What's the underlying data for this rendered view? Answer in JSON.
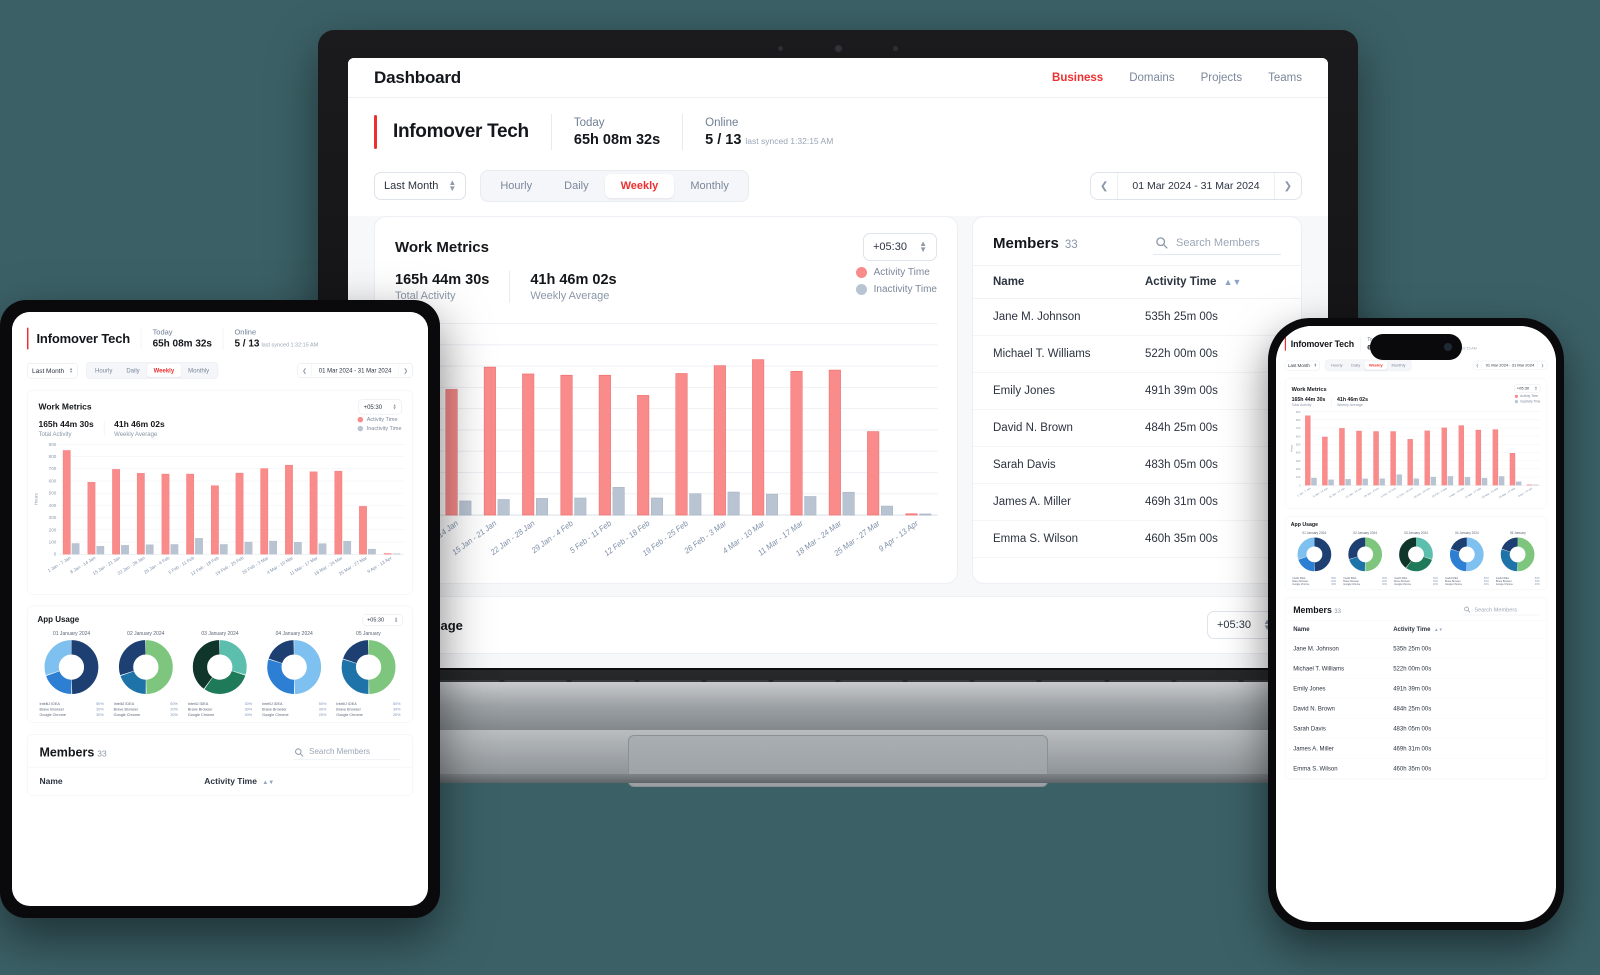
{
  "header": {
    "app_title": "Dashboard",
    "nav": [
      {
        "label": "Business",
        "active": true
      },
      {
        "label": "Domains",
        "active": false
      },
      {
        "label": "Projects",
        "active": false
      },
      {
        "label": "Teams",
        "active": false
      }
    ]
  },
  "brand": {
    "name": "Infomover Tech",
    "today_label": "Today",
    "today_value": "65h 08m 32s",
    "online_label": "Online",
    "online_value": "5 / 13",
    "last_synced": "last synced 1:32:15 AM"
  },
  "filters": {
    "period_select": "Last Month",
    "segments": [
      {
        "label": "Hourly",
        "active": false
      },
      {
        "label": "Daily",
        "active": false
      },
      {
        "label": "Weekly",
        "active": true
      },
      {
        "label": "Monthly",
        "active": false
      }
    ],
    "date_range": "01 Mar 2024 - 31 Mar 2024",
    "prev_icon": "chevron-left-icon",
    "next_icon": "chevron-right-icon"
  },
  "work_metrics": {
    "title": "Work Metrics",
    "timezone": "+05:30",
    "total_activity_value": "165h 44m 30s",
    "total_activity_label": "Total Activity",
    "weekly_average_value": "41h 46m 02s",
    "weekly_average_label": "Weekly Average",
    "legend": [
      {
        "label": "Activity Time",
        "color": "#f98b8b"
      },
      {
        "label": "Inactivity Time",
        "color": "#b9c4d2"
      }
    ]
  },
  "chart_data": {
    "type": "bar",
    "title": "Work Metrics",
    "xlabel": "",
    "ylabel": "Hours",
    "ylim": [
      0,
      900
    ],
    "yticks": [
      0,
      100,
      200,
      300,
      400,
      500,
      600,
      700,
      800,
      900
    ],
    "grid": true,
    "legend_position": "top-right",
    "categories": [
      "1 Jan - 7 Jan",
      "8 Jan - 14 Jan",
      "15 Jan - 21 Jan",
      "22 Jan - 28 Jan",
      "29 Jan - 4 Feb",
      "5 Feb - 11 Feb",
      "12 Feb - 18 Feb",
      "19 Feb - 25 Feb",
      "26 Feb - 3 Mar",
      "4 Mar - 10 Mar",
      "11 Mar - 17 Mar",
      "18 Mar - 24 Mar",
      "25 Mar - 27 Mar",
      "9 Apr - 13 Apr"
    ],
    "series": [
      {
        "name": "Activity Time",
        "color": "#f98b8b",
        "values": [
          850,
          590,
          695,
          663,
          657,
          657,
          562,
          665,
          702,
          730,
          675,
          681,
          392,
          6
        ]
      },
      {
        "name": "Inactivity Time",
        "color": "#b9c4d2",
        "values": [
          88,
          66,
          73,
          78,
          80,
          130,
          80,
          100,
          108,
          98,
          87,
          107,
          42,
          3
        ]
      }
    ]
  },
  "members": {
    "title": "Members",
    "count": "33",
    "search_placeholder": "Search Members",
    "search_icon": "search-icon",
    "columns": [
      "Name",
      "Activity Time"
    ],
    "sort_icon": "sort-updown-icon",
    "rows": [
      {
        "name": "Jane M. Johnson",
        "activity": "535h 25m 00s"
      },
      {
        "name": "Michael T. Williams",
        "activity": "522h 00m 00s"
      },
      {
        "name": "Emily Jones",
        "activity": "491h 39m 00s"
      },
      {
        "name": "David N. Brown",
        "activity": "484h 25m 00s"
      },
      {
        "name": "Sarah Davis",
        "activity": "483h 05m 00s"
      },
      {
        "name": "James A. Miller",
        "activity": "469h 31m 00s"
      },
      {
        "name": "Emma S. Wilson",
        "activity": "460h 35m 00s"
      }
    ]
  },
  "app_usage": {
    "title": "App Usage",
    "timezone": "+05:30",
    "charts": [
      {
        "date": "01 January 2024",
        "slices": [
          {
            "label": "IntelliJ IDEA",
            "pct": "50%",
            "value": 50,
            "color": "#1d3f72"
          },
          {
            "label": "Brave Browser",
            "pct": "20%",
            "value": 20,
            "color": "#2d7fd4"
          },
          {
            "label": "Google Chrome",
            "pct": "30%",
            "value": 30,
            "color": "#7ec0ef"
          }
        ]
      },
      {
        "date": "02 January 2024",
        "slices": [
          {
            "label": "IntelliJ IDEA",
            "pct": "50%",
            "value": 50,
            "color": "#7ec67e"
          },
          {
            "label": "Brave Browser",
            "pct": "20%",
            "value": 20,
            "color": "#1e73a8"
          },
          {
            "label": "Google Chrome",
            "pct": "30%",
            "value": 30,
            "color": "#1d3f72"
          }
        ]
      },
      {
        "date": "03 January 2024",
        "slices": [
          {
            "label": "IntelliJ IDEA",
            "pct": "30%",
            "value": 30,
            "color": "#5cbfae"
          },
          {
            "label": "Brave Browser",
            "pct": "30%",
            "value": 30,
            "color": "#1f7a5a"
          },
          {
            "label": "Google Chrome",
            "pct": "40%",
            "value": 40,
            "color": "#10352a"
          }
        ]
      },
      {
        "date": "04 January 2024",
        "slices": [
          {
            "label": "IntelliJ IDEA",
            "pct": "50%",
            "value": 50,
            "color": "#7ec0ef"
          },
          {
            "label": "Brave Browser",
            "pct": "30%",
            "value": 30,
            "color": "#2d7fd4"
          },
          {
            "label": "Google Chrome",
            "pct": "20%",
            "value": 20,
            "color": "#1d3f72"
          }
        ]
      },
      {
        "date": "05 January",
        "slices": [
          {
            "label": "IntelliJ IDEA",
            "pct": "50%",
            "value": 50,
            "color": "#7ec67e"
          },
          {
            "label": "Brave Browser",
            "pct": "30%",
            "value": 30,
            "color": "#1e73a8"
          },
          {
            "label": "Google Chrome",
            "pct": "20%",
            "value": 20,
            "color": "#1d3f72"
          }
        ]
      }
    ]
  },
  "theme": {
    "accent": "#ef2f2f",
    "activity": "#f98b8b",
    "inactivity": "#b9c4d2",
    "background": "#3b6167",
    "muted_text": "#7b879b"
  }
}
